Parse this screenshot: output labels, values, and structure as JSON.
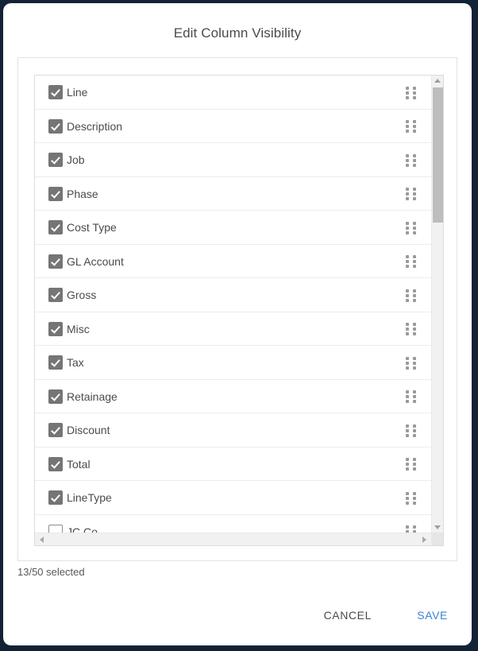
{
  "dialog": {
    "title": "Edit Column Visibility",
    "selected_count_text": "13/50 selected"
  },
  "colors": {
    "page_background": "#132337",
    "dialog_background": "#ffffff",
    "checkbox_checked": "#757575",
    "checkbox_unchecked_border": "#8d8d8d",
    "title_text": "#4a4a4a",
    "row_text": "#4b4b4b",
    "save_accent": "#3b82d6",
    "cancel_text": "#4a4a4a",
    "scrollbar_track": "#f1f1f1",
    "scrollbar_thumb": "#bdbdbd",
    "drag_handle_dots": "#9a9a9a"
  },
  "columns": [
    {
      "label": "Line",
      "checked": true
    },
    {
      "label": "Description",
      "checked": true
    },
    {
      "label": "Job",
      "checked": true
    },
    {
      "label": "Phase",
      "checked": true
    },
    {
      "label": "Cost Type",
      "checked": true
    },
    {
      "label": "GL Account",
      "checked": true
    },
    {
      "label": "Gross",
      "checked": true
    },
    {
      "label": "Misc",
      "checked": true
    },
    {
      "label": "Tax",
      "checked": true
    },
    {
      "label": "Retainage",
      "checked": true
    },
    {
      "label": "Discount",
      "checked": true
    },
    {
      "label": "Total",
      "checked": true
    },
    {
      "label": "LineType",
      "checked": true
    },
    {
      "label": "JC Co",
      "checked": false
    }
  ],
  "scrollbars": {
    "vertical": {
      "up_arrow_icon": "caret-up-icon",
      "down_arrow_icon": "caret-down-icon"
    },
    "horizontal": {
      "left_arrow_icon": "caret-left-icon",
      "right_arrow_icon": "caret-right-icon"
    }
  },
  "footer": {
    "cancel_label": "CANCEL",
    "save_label": "SAVE"
  },
  "icons": {
    "drag_handle": "drag-handle-icon"
  }
}
